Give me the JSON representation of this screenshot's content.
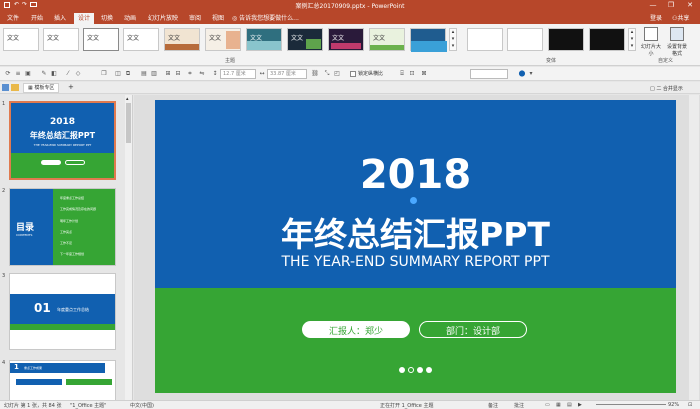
{
  "title_bar": {
    "title": "案例汇总20170909.pptx - PowerPoint",
    "minimize": "—",
    "restore": "❐",
    "close": "✕"
  },
  "ribbon_tabs": [
    {
      "label": "文件",
      "active": false
    },
    {
      "label": "开始",
      "active": false
    },
    {
      "label": "插入",
      "active": false
    },
    {
      "label": "设计",
      "active": true
    },
    {
      "label": "切换",
      "active": false
    },
    {
      "label": "动画",
      "active": false
    },
    {
      "label": "幻灯片放映",
      "active": false
    },
    {
      "label": "审阅",
      "active": false
    },
    {
      "label": "视图",
      "active": false
    }
  ],
  "search_hint": "告诉我您想要做什么...",
  "signin_label": "登录",
  "share_label": "共享",
  "themes": {
    "group_label": "主题",
    "items": [
      "文文",
      "文文",
      "文文",
      "文文",
      "文文",
      "文文",
      "文文",
      "文文",
      "文文",
      "文文"
    ]
  },
  "variants": {
    "group_label": "变体"
  },
  "customize": {
    "group_label": "自定义",
    "slide_size_label": "幻灯片大小",
    "format_bg_label": "设置背景格式"
  },
  "format_toolbar": {
    "width_value": "12.7 厘米",
    "height_value": "33.87 厘米",
    "lock_label": "锁定纵横比"
  },
  "doc_tab": {
    "label": "模板专区",
    "add": "+"
  },
  "right_label": "□ 二 合并显示",
  "thumbnails": {
    "numbers": [
      "1",
      "2",
      "3",
      "4"
    ],
    "slide1": {
      "year": "2018",
      "title": "年终总结汇报PPT",
      "subtitle": "THE YEAR-END SUMMARY REPORT PPT"
    },
    "slide2": {
      "title": "目录",
      "subtitle": "CONTENTS",
      "items": [
        "年度重点工作总结",
        "工作完成情况及存在的问题",
        "明年工作计划",
        "工作亮点",
        "工作不足",
        "下一年度工作规划"
      ]
    },
    "slide3": {
      "number": "01",
      "title": "年度重点工作总结"
    },
    "slide4": {
      "number": "1",
      "title": "重点工作成果"
    }
  },
  "slide": {
    "year": "2018",
    "title": "年终总结汇报PPT",
    "subtitle": "THE YEAR-END SUMMARY REPORT PPT",
    "reporter_label": "汇报人：郑少",
    "department_label": "部门：设计部"
  },
  "status_bar": {
    "slide_info": "幻灯片 第 1 张，共 84 张",
    "theme_name": "\"1_Office 主题\"",
    "language": "中文(中国)",
    "recording": "正在打开 1_Office 主题",
    "notes_label": "备注",
    "comments_label": "批注",
    "zoom": "92%"
  },
  "colors": {
    "ppt_red": "#b7472a",
    "slide_blue": "#1160b0",
    "slide_green": "#36a534",
    "thumb_selected": "#e07a4f"
  }
}
